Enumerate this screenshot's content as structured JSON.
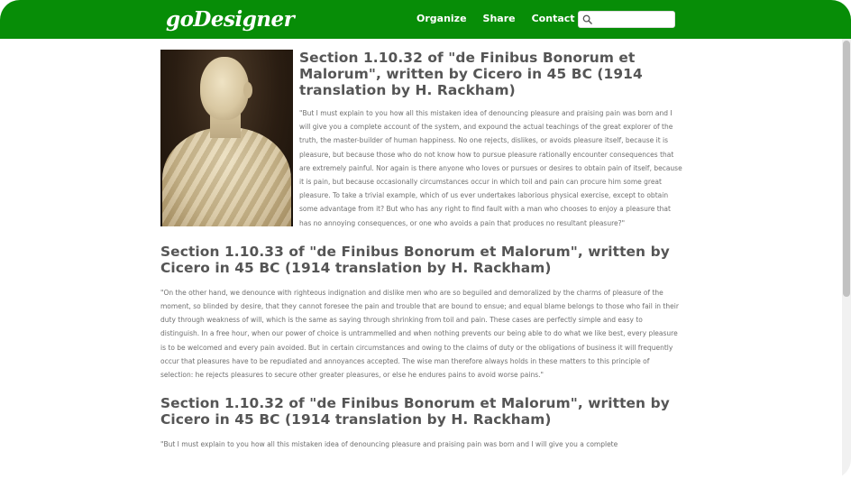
{
  "brand": {
    "logo_text": "goDesigner",
    "color": "#078d07"
  },
  "nav": {
    "items": [
      {
        "label": "Organize"
      },
      {
        "label": "Share"
      },
      {
        "label": "Contact"
      }
    ]
  },
  "search": {
    "placeholder": "",
    "value": "",
    "icon": "search-icon"
  },
  "article": {
    "image": {
      "subject": "marble bust of Cicero"
    },
    "sections": [
      {
        "heading": "Section 1.10.32 of \"de Finibus Bonorum et Malorum\", written by Cicero in 45 BC (1914 translation by H. Rackham)",
        "body": "\"But I must explain to you how all this mistaken idea of denouncing pleasure and praising pain was born and I will give you a complete account of the system, and expound the actual teachings of the great explorer of the truth, the master-builder of human happiness. No one rejects, dislikes, or avoids pleasure itself, because it is pleasure, but because those who do not know how to pursue pleasure rationally encounter consequences that are extremely painful. Nor again is there anyone who loves or pursues or desires to obtain pain of itself, because it is pain, but because occasionally circumstances occur in which toil and pain can procure him some great pleasure. To take a trivial example, which of us ever undertakes laborious physical exercise, except to obtain some advantage from it? But who has any right to find fault with a man who chooses to enjoy a pleasure that has no annoying consequences, or one who avoids a pain that produces no resultant pleasure?\""
      },
      {
        "heading": "Section 1.10.33 of \"de Finibus Bonorum et Malorum\", written by Cicero in 45 BC (1914 translation by H. Rackham)",
        "body": "\"On the other hand, we denounce with righteous indignation and dislike men who are so beguiled and demoralized by the charms of pleasure of the moment, so blinded by desire, that they cannot foresee the pain and trouble that are bound to ensue; and equal blame belongs to those who fail in their duty through weakness of will, which is the same as saying through shrinking from toil and pain. These cases are perfectly simple and easy to distinguish. In a free hour, when our power of choice is untrammelled and when nothing prevents our being able to do what we like best, every pleasure is to be welcomed and every pain avoided. But in certain circumstances and owing to the claims of duty or the obligations of business it will frequently occur that pleasures have to be repudiated and annoyances accepted. The wise man therefore always holds in these matters to this principle of selection: he rejects pleasures to secure other greater pleasures, or else he endures pains to avoid worse pains.\""
      },
      {
        "heading": "Section 1.10.32 of \"de Finibus Bonorum et Malorum\", written by Cicero in 45 BC (1914 translation by H. Rackham)",
        "body": "\"But I must explain to you how all this mistaken idea of denouncing pleasure and praising pain was born and I will give you a complete"
      }
    ]
  }
}
